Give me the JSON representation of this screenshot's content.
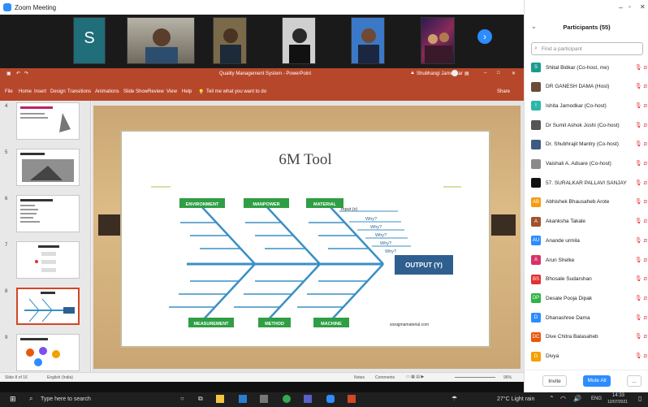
{
  "window": {
    "title": "Zoom Meeting"
  },
  "gallery": {
    "tiles": [
      {
        "initial": "S"
      }
    ],
    "next_label": "›"
  },
  "powerpoint": {
    "title": "Quality Management System - PowerPoint",
    "user": "Shubhangi Jamodkar",
    "ribbon_tabs": [
      "File",
      "Home",
      "Insert",
      "Design",
      "Transitions",
      "Animations",
      "Slide Show",
      "Review",
      "View",
      "Help"
    ],
    "tell_me": "Tell me what you want to do",
    "share": "Share",
    "slide_numbers": [
      "4",
      "5",
      "6",
      "7",
      "8",
      "9"
    ],
    "status_left": "Slide 8 of 16",
    "language": "English (India)",
    "notes": "Notes",
    "comments": "Comments",
    "zoom": "96%"
  },
  "slide": {
    "title": "6M Tool",
    "categories_top": [
      "ENVIRONMENT",
      "MANPOWER",
      "MATERIAL"
    ],
    "categories_bottom": [
      "MEASUREMENT",
      "METHOD",
      "MACHINE"
    ],
    "input_label": "Input (x)",
    "why_labels": [
      "Why?",
      "Why?",
      "Why?",
      "Why?",
      "Why?"
    ],
    "output_label": "OUTPUT (Y)",
    "watermark": "sixsigmamaterial.com"
  },
  "participants": {
    "header": "Participants (55)",
    "search_placeholder": "Find a participant",
    "list": [
      {
        "initial": "S",
        "name": "Shital Bidkar (Co-host, me)",
        "color": "#1a9c8c"
      },
      {
        "initial": "",
        "name": "DR GANESH DAMA (Host)",
        "color": "#6b4b3a"
      },
      {
        "initial": "I",
        "name": "Ishita Jamodkar (Co-host)",
        "color": "#2bb7a9"
      },
      {
        "initial": "",
        "name": "Dr Sumit Ashok Joshi (Co-host)",
        "color": "#555555"
      },
      {
        "initial": "",
        "name": "Dr. Shubhrajit Mantry (Co-host)",
        "color": "#3d5a80"
      },
      {
        "initial": "",
        "name": "Vaishali A. Adsare (Co-host)",
        "color": "#8a8a8a"
      },
      {
        "initial": "",
        "name": "57. SURALKAR PALLAVI SANJAY",
        "color": "#111111"
      },
      {
        "initial": "AB",
        "name": "Abhishek Bhausaheb Arote",
        "color": "#f39c12"
      },
      {
        "initial": "A",
        "name": "Akanksha Takale",
        "color": "#a0522d"
      },
      {
        "initial": "AU",
        "name": "Anande urmila",
        "color": "#2d8cff"
      },
      {
        "initial": "A",
        "name": "Arun Shelke",
        "color": "#d6336c"
      },
      {
        "initial": "BS",
        "name": "Bhosale Sudarshan",
        "color": "#e03131"
      },
      {
        "initial": "DP",
        "name": "Desale Pooja Dipak",
        "color": "#2fb344"
      },
      {
        "initial": "D",
        "name": "Dhanashree Dama",
        "color": "#2d8cff"
      },
      {
        "initial": "DC",
        "name": "Dive Chitra Balasaheb",
        "color": "#e8590c"
      },
      {
        "initial": "D",
        "name": "Divya",
        "color": "#f59f00"
      }
    ],
    "invite": "Invite",
    "mute_all": "Mute All",
    "more": "..."
  },
  "taskbar": {
    "search": "Type here to search",
    "weather": "27°C Light rain",
    "language": "ENG",
    "time": "14:33",
    "date": "12/07/2021"
  }
}
